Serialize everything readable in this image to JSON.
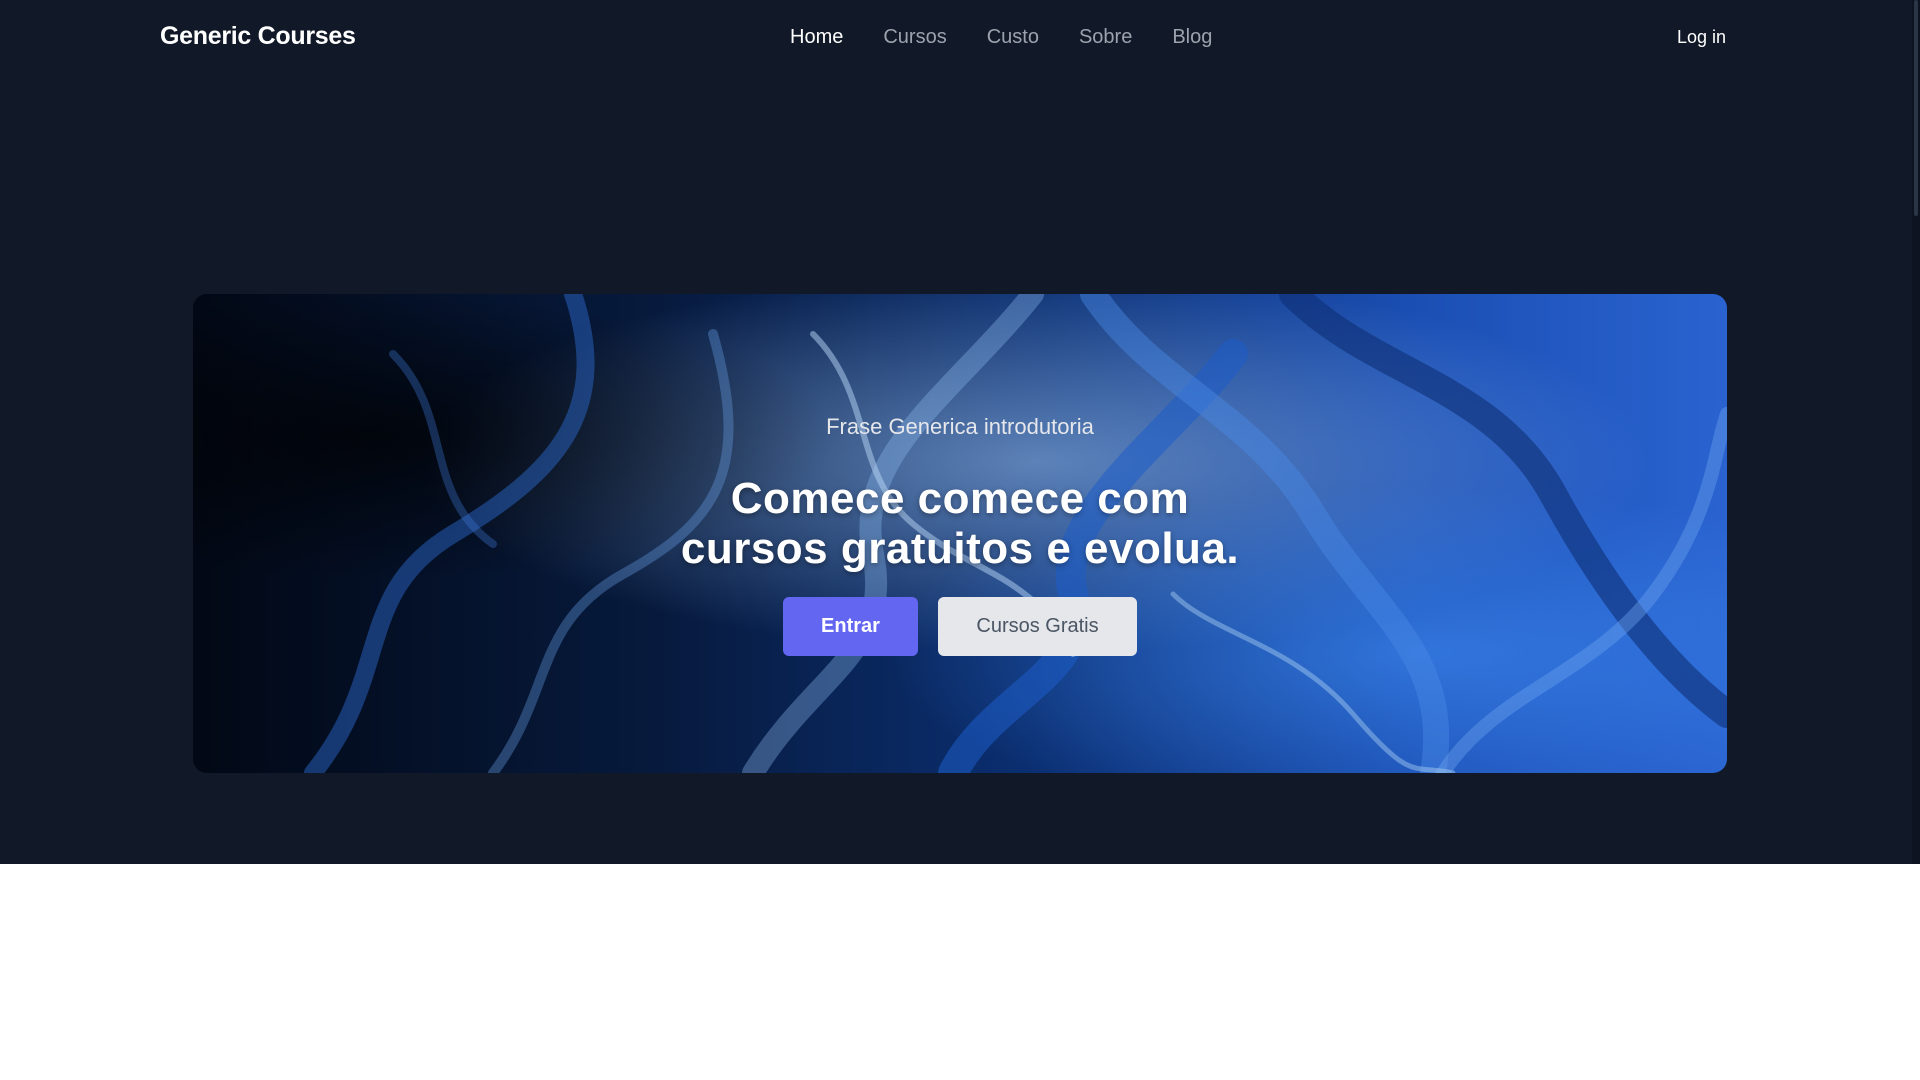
{
  "colors": {
    "page_background": "#111827",
    "accent": "#6366f1",
    "secondary_button": "#e5e7eb",
    "nav_inactive": "#9ca3af"
  },
  "header": {
    "brand": "Generic Courses",
    "nav": [
      {
        "label": "Home",
        "active": true
      },
      {
        "label": "Cursos",
        "active": false
      },
      {
        "label": "Custo",
        "active": false
      },
      {
        "label": "Sobre",
        "active": false
      },
      {
        "label": "Blog",
        "active": false
      }
    ],
    "login_label": "Log in"
  },
  "hero": {
    "eyebrow": "Frase Generica introdutoria",
    "headline_line1": "Comece comece com",
    "headline_line2": "cursos gratuitos e evolua.",
    "primary_button": "Entrar",
    "secondary_button": "Cursos Gratis",
    "background_image": "blue-marble-fluid-art"
  }
}
